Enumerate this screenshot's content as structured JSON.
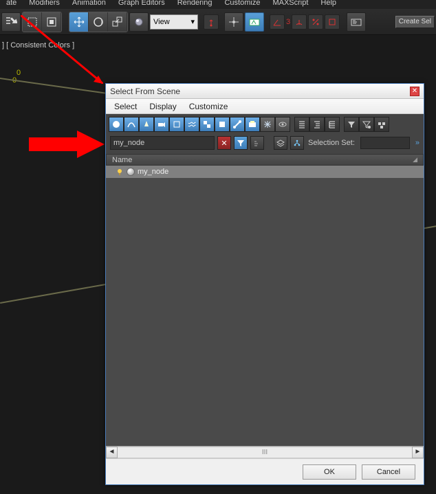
{
  "menubar": [
    "ate",
    "Modifiers",
    "Animation",
    "Graph Editors",
    "Rendering",
    "Customize",
    "MAXScript",
    "Help"
  ],
  "main_toolbar": {
    "view_label": "View",
    "three_label": "3"
  },
  "create_btn": "Create Sel",
  "viewport_label": "] [ Consistent Colors ]",
  "axis": {
    "y": "0",
    "o": "0"
  },
  "dialog": {
    "title": "Select From Scene",
    "menu": [
      "Select",
      "Display",
      "Customize"
    ],
    "search_value": "my_node",
    "selection_set_label": "Selection Set:",
    "col_header": "Name",
    "rows": [
      {
        "name": "my_node"
      }
    ],
    "scroll_label": "III",
    "buttons": {
      "ok": "OK",
      "cancel": "Cancel"
    }
  }
}
